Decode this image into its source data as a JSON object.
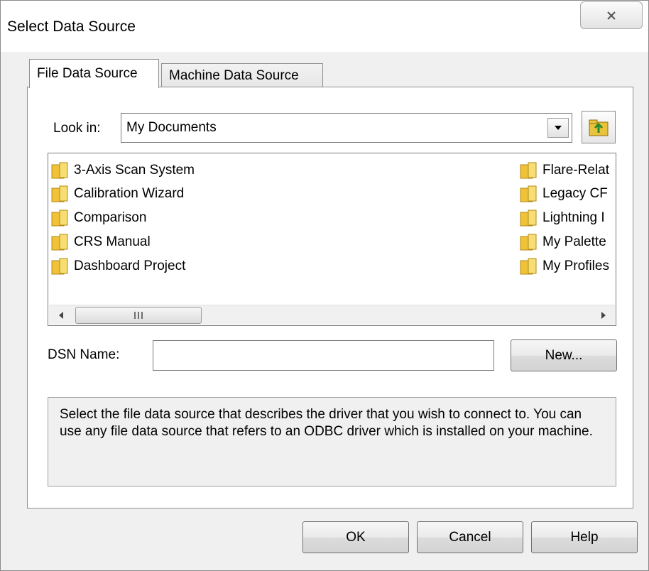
{
  "window": {
    "title": "Select Data Source",
    "close_symbol": "✕"
  },
  "tabs": [
    {
      "label": "File Data Source",
      "active": true
    },
    {
      "label": "Machine Data Source",
      "active": false
    }
  ],
  "look_in": {
    "label": "Look in:",
    "value": "My Documents"
  },
  "files": {
    "left_column": [
      "3-Axis Scan System",
      "Calibration Wizard",
      "Comparison",
      "CRS Manual",
      "Dashboard Project"
    ],
    "right_column": [
      "Flare-Relat",
      "Legacy CF",
      "Lightning I",
      "My Palette",
      "My Profiles"
    ]
  },
  "dsn": {
    "label": "DSN Name:",
    "value": "",
    "new_button": "New..."
  },
  "description": "Select the file data source that describes the driver that you wish to connect to. You can use any file data source that refers to an ODBC driver which is installed on your machine.",
  "buttons": {
    "ok": "OK",
    "cancel": "Cancel",
    "help": "Help"
  },
  "colors": {
    "window_bg": "#f0f0f0",
    "folder_yellow": "#f5c842",
    "panel_bg": "#ffffff"
  }
}
